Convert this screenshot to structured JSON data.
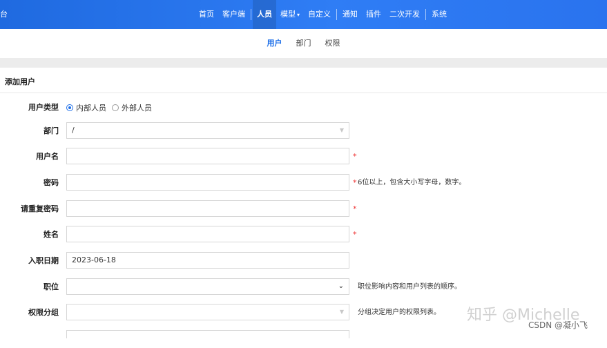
{
  "topbar": {
    "brand": "台",
    "nav": [
      {
        "label": "首页"
      },
      {
        "label": "客户端"
      },
      {
        "label": "人员",
        "active": true
      },
      {
        "label": "模型"
      },
      {
        "label": "自定义"
      },
      {
        "label": "通知"
      },
      {
        "label": "插件"
      },
      {
        "label": "二次开发"
      },
      {
        "label": "系统"
      }
    ],
    "dropdown_caret": "▾"
  },
  "subnav": [
    {
      "label": "用户",
      "active": true
    },
    {
      "label": "部门"
    },
    {
      "label": "权限"
    }
  ],
  "section_title": "添加用户",
  "form": {
    "user_type": {
      "label": "用户类型",
      "options": [
        "内部人员",
        "外部人员"
      ],
      "selected": "内部人员"
    },
    "department": {
      "label": "部门",
      "value": "/"
    },
    "username": {
      "label": "用户名",
      "value": "",
      "required_mark": "*"
    },
    "password": {
      "label": "密码",
      "value": "",
      "required_mark": "*",
      "hint": "6位以上，包含大小写字母，数字。"
    },
    "password_confirm": {
      "label": "请重复密码",
      "value": "",
      "required_mark": "*"
    },
    "full_name": {
      "label": "姓名",
      "value": "",
      "required_mark": "*"
    },
    "hire_date": {
      "label": "入职日期",
      "value": "2023-06-18"
    },
    "position": {
      "label": "职位",
      "value": "",
      "hint": "职位影响内容和用户列表的顺序。"
    },
    "permission_group": {
      "label": "权限分组",
      "value": "",
      "hint": "分组决定用户的权限列表。"
    }
  },
  "watermark": {
    "main": "知乎 @Michelle",
    "sub": "CSDN @凝小飞"
  },
  "colors": {
    "accent": "#1e6fe8",
    "topbar": "#2a73ee",
    "required": "#e33333"
  }
}
